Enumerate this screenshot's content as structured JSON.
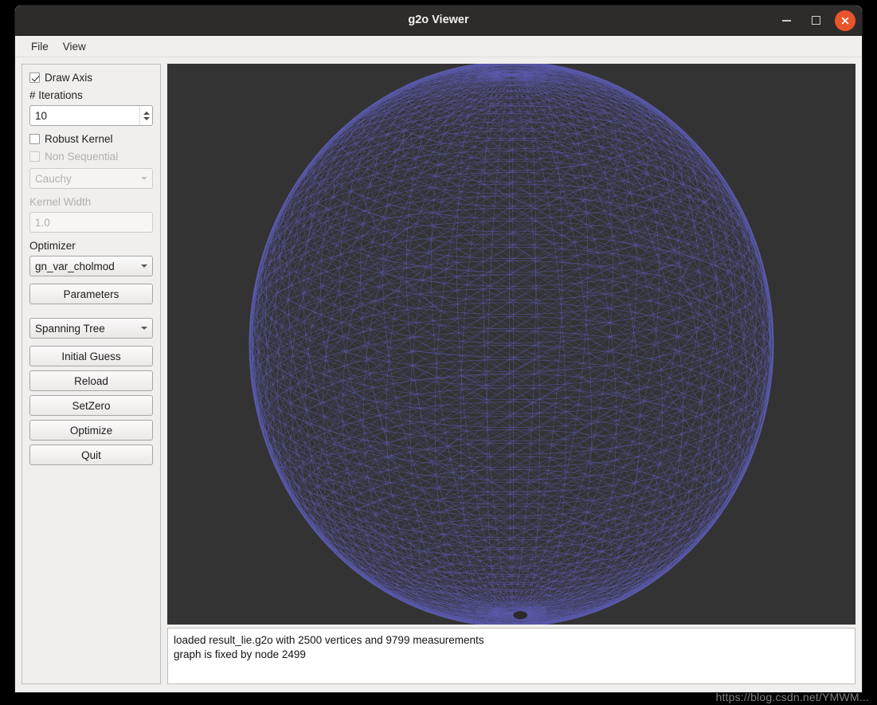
{
  "window": {
    "title": "g2o Viewer",
    "controls": {
      "minimize": "minimize",
      "maximize": "maximize",
      "close": "close"
    }
  },
  "menubar": {
    "items": [
      {
        "label": "File"
      },
      {
        "label": "View"
      }
    ]
  },
  "sidebar": {
    "draw_axis": {
      "label": "Draw Axis",
      "checked": true
    },
    "iterations": {
      "label": "# Iterations",
      "value": "10"
    },
    "robust_kernel": {
      "label": "Robust Kernel",
      "checked": false
    },
    "non_sequential": {
      "label": "Non Sequential",
      "checked": false,
      "enabled": false
    },
    "kernel_type": {
      "value": "Cauchy",
      "enabled": false
    },
    "kernel_width": {
      "label": "Kernel Width",
      "value": "1.0",
      "enabled": false
    },
    "optimizer": {
      "label": "Optimizer",
      "value": "gn_var_cholmod"
    },
    "parameters_button": "Parameters",
    "init_method": {
      "value": "Spanning Tree"
    },
    "buttons": [
      {
        "label": "Initial Guess"
      },
      {
        "label": "Reload"
      },
      {
        "label": "SetZero"
      },
      {
        "label": "Optimize"
      },
      {
        "label": "Quit"
      }
    ]
  },
  "viewport": {
    "background_color": "#333333",
    "mesh_color": "#5a5aad",
    "description": "3D wireframe sphere pose graph"
  },
  "status": {
    "line1": "loaded result_lie.g2o with 2500 vertices and 9799 measurements",
    "line2": "graph is fixed by node 2499"
  },
  "watermark": {
    "text": "https://blog.csdn.net/YMWM..."
  }
}
